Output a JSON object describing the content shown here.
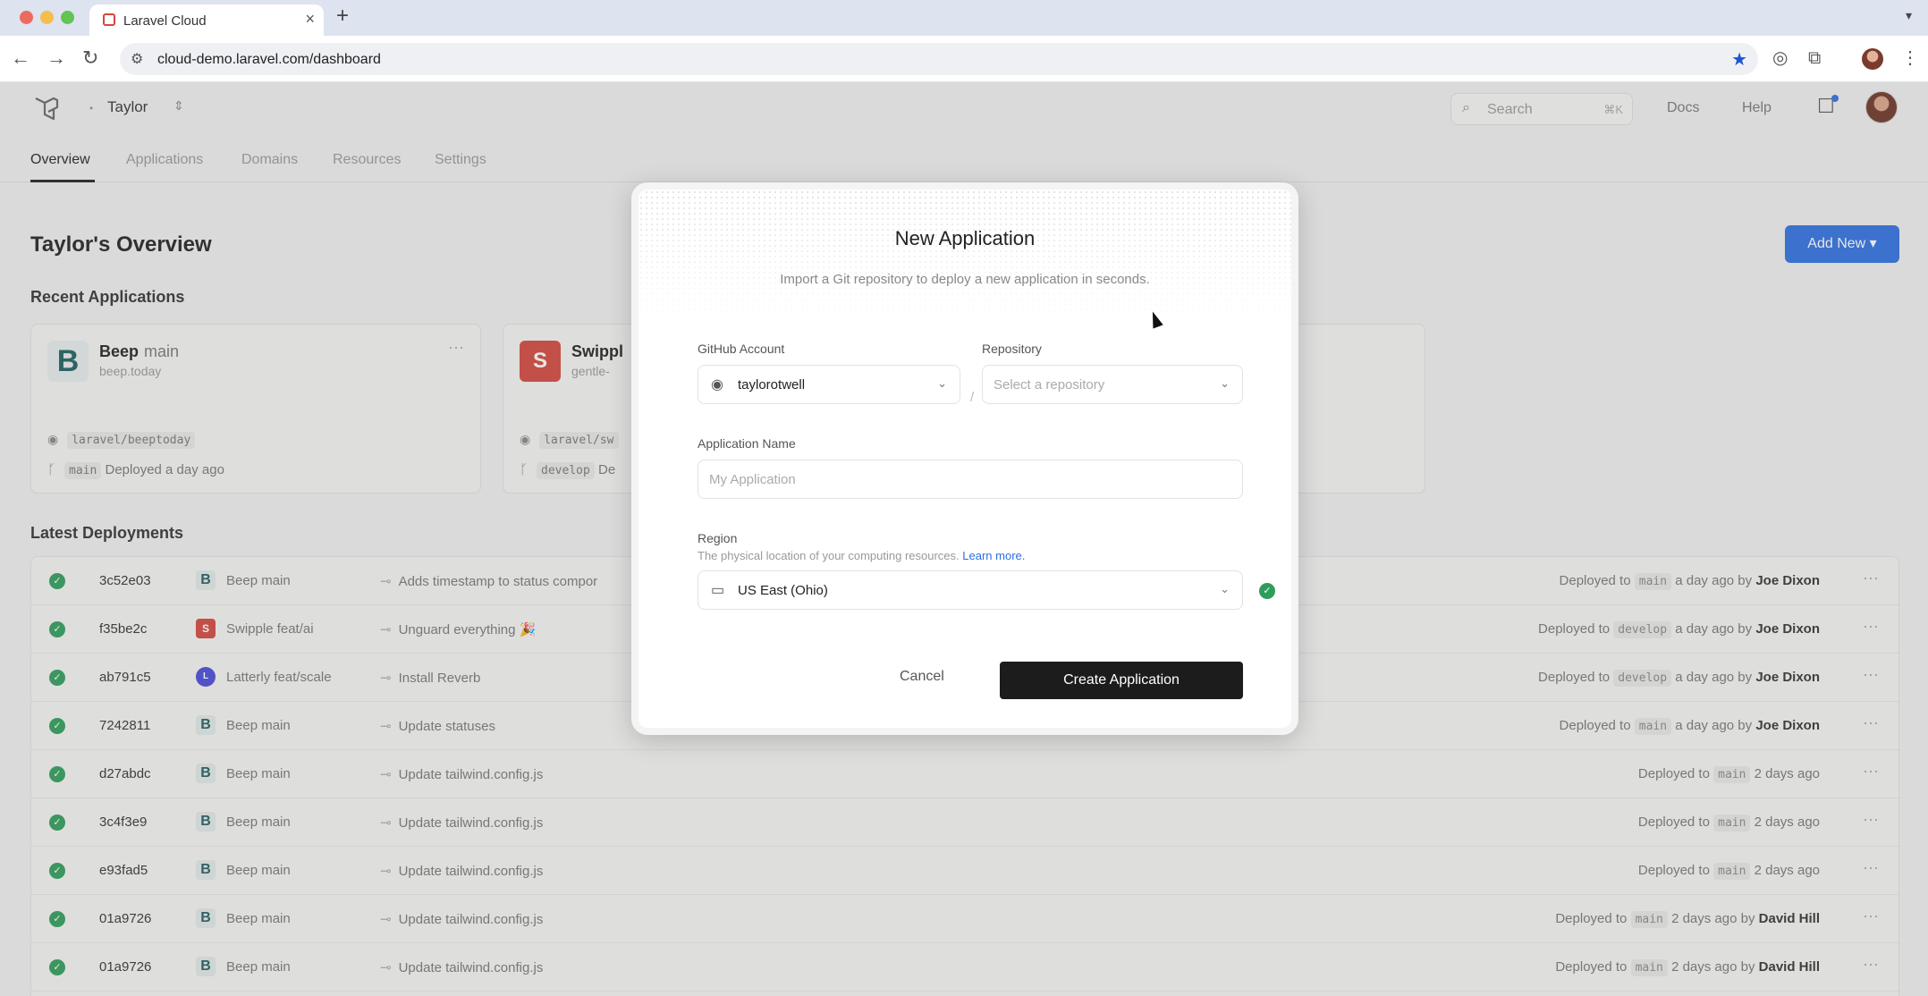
{
  "browser": {
    "tab_title": "Laravel Cloud",
    "url": "cloud-demo.laravel.com/dashboard"
  },
  "header": {
    "team_name": "Taylor",
    "search_placeholder": "Search",
    "search_shortcut": "⌘K",
    "docs_label": "Docs",
    "help_label": "Help"
  },
  "nav_tabs": [
    {
      "label": "Overview",
      "active": true
    },
    {
      "label": "Applications"
    },
    {
      "label": "Domains"
    },
    {
      "label": "Resources"
    },
    {
      "label": "Settings"
    }
  ],
  "page": {
    "title": "Taylor's Overview",
    "add_new_label": "Add New",
    "recent_title": "Recent Applications",
    "deployments_title": "Latest Deployments"
  },
  "recent_apps": [
    {
      "badge": "B",
      "name": "Beep",
      "branch": "main",
      "url": "beep.today",
      "repo": "laravel/beeptoday",
      "deploy_branch": "main",
      "deploy_text": "Deployed a day ago"
    },
    {
      "badge": "S",
      "name": "Swippl",
      "branch": "",
      "url": "gentle-",
      "repo": "laravel/sw",
      "deploy_branch": "develop",
      "deploy_text": "De"
    }
  ],
  "deployments": [
    {
      "sha": "3c52e03",
      "icon": "B",
      "app": "Beep main",
      "commit": "Adds timestamp to status compor",
      "prefix": "Deployed to",
      "branch": "main",
      "suffix": "a day ago by",
      "author": "Joe Dixon"
    },
    {
      "sha": "f35be2c",
      "icon": "S",
      "app": "Swipple feat/ai",
      "commit": "Unguard everything 🎉",
      "prefix": "Deployed to",
      "branch": "develop",
      "suffix": "a day ago by",
      "author": "Joe Dixon"
    },
    {
      "sha": "ab791c5",
      "icon": "L",
      "app": "Latterly feat/scale",
      "commit": "Install Reverb",
      "prefix": "Deployed to",
      "branch": "develop",
      "suffix": "a day ago by",
      "author": "Joe Dixon"
    },
    {
      "sha": "7242811",
      "icon": "B",
      "app": "Beep main",
      "commit": "Update statuses",
      "prefix": "Deployed to",
      "branch": "main",
      "suffix": "a day ago by",
      "author": "Joe Dixon"
    },
    {
      "sha": "d27abdc",
      "icon": "B",
      "app": "Beep main",
      "commit": "Update tailwind.config.js",
      "prefix": "Deployed to",
      "branch": "main",
      "suffix": "2 days ago",
      "author": ""
    },
    {
      "sha": "3c4f3e9",
      "icon": "B",
      "app": "Beep main",
      "commit": "Update tailwind.config.js",
      "prefix": "Deployed to",
      "branch": "main",
      "suffix": "2 days ago",
      "author": ""
    },
    {
      "sha": "e93fad5",
      "icon": "B",
      "app": "Beep main",
      "commit": "Update tailwind.config.js",
      "prefix": "Deployed to",
      "branch": "main",
      "suffix": "2 days ago",
      "author": ""
    },
    {
      "sha": "01a9726",
      "icon": "B",
      "app": "Beep main",
      "commit": "Update tailwind.config.js",
      "prefix": "Deployed to",
      "branch": "main",
      "suffix": "2 days ago by",
      "author": "David Hill"
    },
    {
      "sha": "01a9726",
      "icon": "B",
      "app": "Beep main",
      "commit": "Update tailwind.config.js",
      "prefix": "Deployed to",
      "branch": "main",
      "suffix": "2 days ago by",
      "author": "David Hill"
    }
  ],
  "modal": {
    "title": "New Application",
    "subtitle": "Import a Git repository to deploy a new application in seconds.",
    "github_label": "GitHub Account",
    "github_value": "taylorotwell",
    "repo_label": "Repository",
    "repo_placeholder": "Select a repository",
    "name_label": "Application Name",
    "name_placeholder": "My Application",
    "region_label": "Region",
    "region_hint": "The physical location of your computing resources.",
    "region_learn_more": "Learn more.",
    "region_value": "US East (Ohio)",
    "cancel_label": "Cancel",
    "create_label": "Create Application"
  },
  "colors": {
    "accent": "#2f6fe0",
    "success": "#2f9d5a",
    "primary_button": "#1c1c1c"
  }
}
